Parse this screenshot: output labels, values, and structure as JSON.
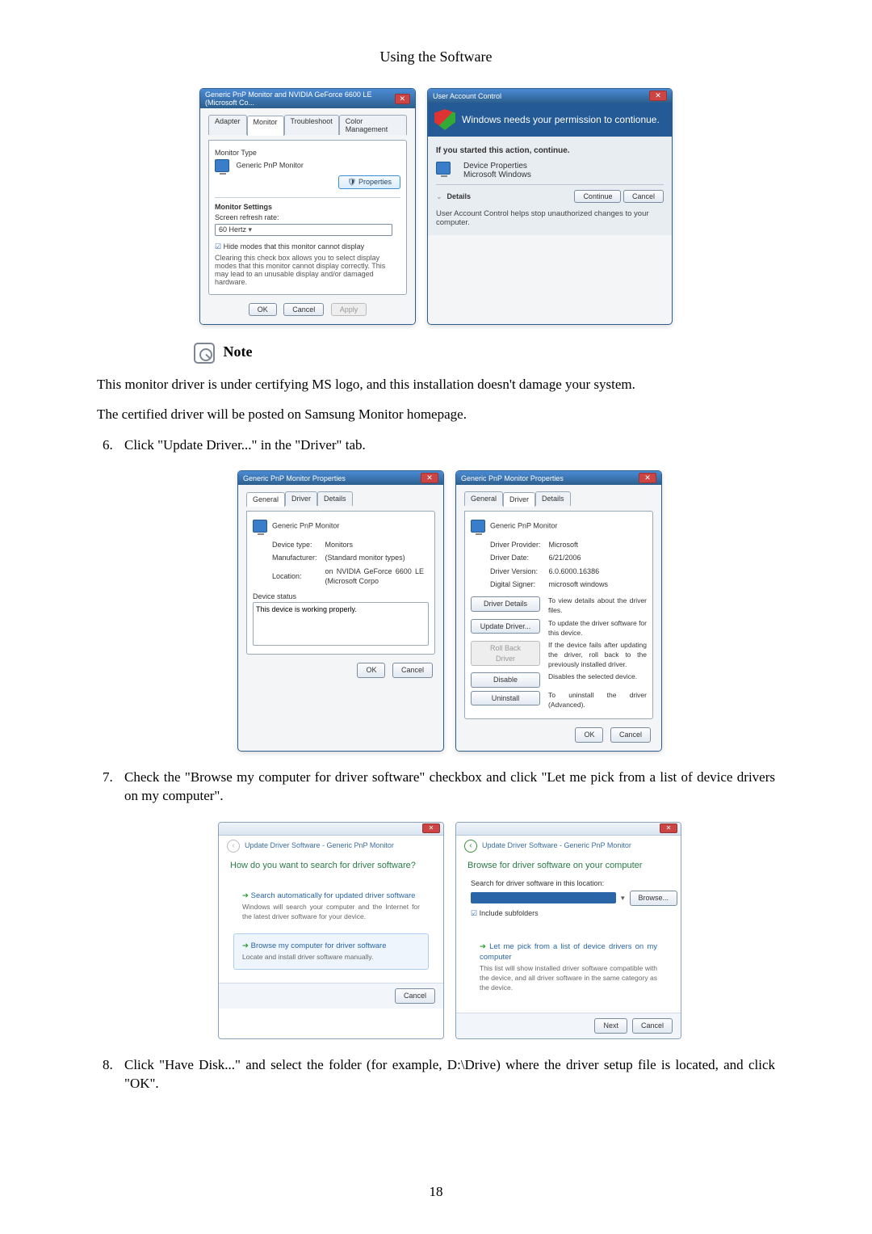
{
  "page": {
    "running_header": "Using the Software",
    "number": "18"
  },
  "note": {
    "label": "Note"
  },
  "paragraphs": {
    "p1": "This monitor driver is under certifying MS logo, and this installation doesn't damage your system.",
    "p2": "The certified driver will be posted on Samsung Monitor homepage."
  },
  "steps": {
    "s6": "Click \"Update Driver...\" in the \"Driver\" tab.",
    "s7": "Check the \"Browse my computer for driver software\" checkbox and click \"Let me pick from a list of device drivers on my computer\".",
    "s8": "Click \"Have Disk...\" and select the folder (for example, D:\\Drive) where the driver setup file is located, and click \"OK\"."
  },
  "fig1": {
    "monitor_dlg": {
      "title": "Generic PnP Monitor and NVIDIA GeForce 6600 LE (Microsoft Co...",
      "tabs": {
        "adapter": "Adapter",
        "monitor": "Monitor",
        "troubleshoot": "Troubleshoot",
        "color": "Color Management"
      },
      "type_label": "Monitor Type",
      "type_value": "Generic PnP Monitor",
      "properties_btn": "Properties",
      "settings_label": "Monitor Settings",
      "refresh_label": "Screen refresh rate:",
      "refresh_value": "60 Hertz",
      "hide_modes_label": "Hide modes that this monitor cannot display",
      "hide_modes_desc": "Clearing this check box allows you to select display modes that this monitor cannot display correctly. This may lead to an unusable display and/or damaged hardware.",
      "ok": "OK",
      "cancel": "Cancel",
      "apply": "Apply"
    },
    "uac": {
      "title": "User Account Control",
      "headline": "Windows needs your permission to contionue.",
      "started": "If you started this action, continue.",
      "item_title": "Device Properties",
      "item_vendor": "Microsoft Windows",
      "details": "Details",
      "continue": "Continue",
      "cancel": "Cancel",
      "footer": "User Account Control helps stop unauthorized changes to your computer."
    }
  },
  "fig2": {
    "gen": {
      "title": "Generic PnP Monitor Properties",
      "tabs": {
        "general": "General",
        "driver": "Driver",
        "details": "Details"
      },
      "name": "Generic PnP Monitor",
      "devtype_l": "Device type:",
      "devtype_v": "Monitors",
      "mfr_l": "Manufacturer:",
      "mfr_v": "(Standard monitor types)",
      "loc_l": "Location:",
      "loc_v": "on NVIDIA GeForce 6600 LE (Microsoft Corpo",
      "status_l": "Device status",
      "status_v": "This device is working properly.",
      "ok": "OK",
      "cancel": "Cancel"
    },
    "drv": {
      "title": "Generic PnP Monitor Properties",
      "tabs": {
        "general": "General",
        "driver": "Driver",
        "details": "Details"
      },
      "name": "Generic PnP Monitor",
      "provider_l": "Driver Provider:",
      "provider_v": "Microsoft",
      "date_l": "Driver Date:",
      "date_v": "6/21/2006",
      "version_l": "Driver Version:",
      "version_v": "6.0.6000.16386",
      "signer_l": "Digital Signer:",
      "signer_v": "microsoft windows",
      "btn_details": "Driver Details",
      "btn_details_d": "To view details about the driver files.",
      "btn_update": "Update Driver...",
      "btn_update_d": "To update the driver software for this device.",
      "btn_rollback": "Roll Back Driver",
      "btn_rollback_d": "If the device fails after updating the driver, roll back to the previously installed driver.",
      "btn_disable": "Disable",
      "btn_disable_d": "Disables the selected device.",
      "btn_uninstall": "Uninstall",
      "btn_uninstall_d": "To uninstall the driver (Advanced).",
      "ok": "OK",
      "cancel": "Cancel"
    }
  },
  "fig3": {
    "w1": {
      "crumb": "Update Driver Software - Generic PnP Monitor",
      "head": "How do you want to search for driver software?",
      "opt_a_title": "Search automatically for updated driver software",
      "opt_a_desc": "Windows will search your computer and the Internet for the latest driver software for your device.",
      "opt_b_title": "Browse my computer for driver software",
      "opt_b_desc": "Locate and install driver software manually.",
      "cancel": "Cancel"
    },
    "w2": {
      "crumb": "Update Driver Software - Generic PnP Monitor",
      "head": "Browse for driver software on your computer",
      "loc_label": "Search for driver software in this location:",
      "loc_value": "",
      "browse": "Browse...",
      "include_sub": "Include subfolders",
      "opt_title": "Let me pick from a list of device drivers on my computer",
      "opt_desc": "This list will show installed driver software compatible with the device, and all driver software in the same category as the device.",
      "next": "Next",
      "cancel": "Cancel"
    }
  }
}
